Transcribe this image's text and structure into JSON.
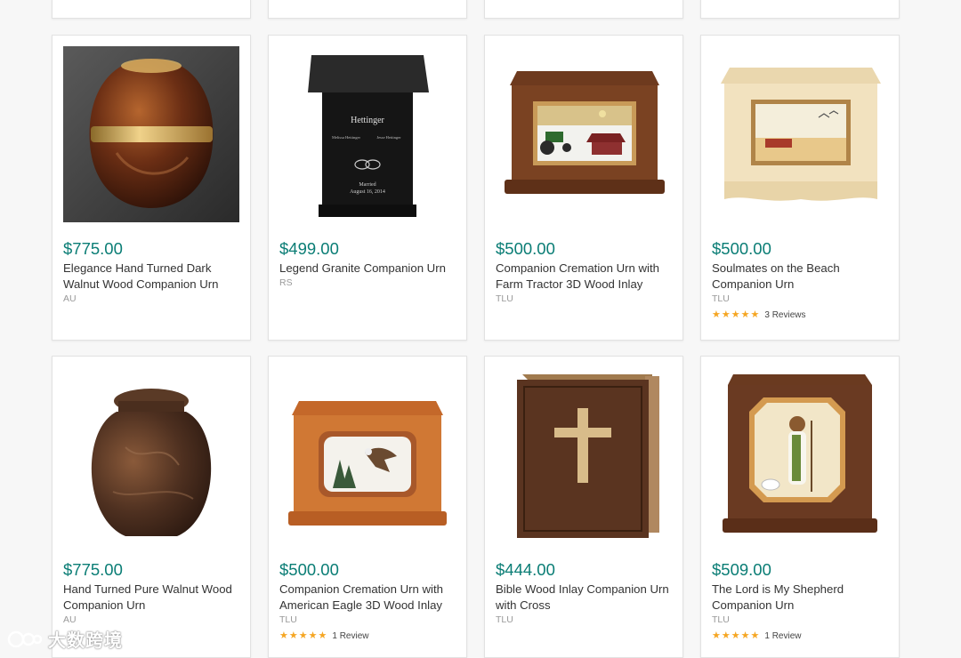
{
  "watermark": {
    "text": "大数跨境"
  },
  "products": [
    {
      "price": "$775.00",
      "title": "Elegance Hand Turned Dark Walnut Wood Companion Urn",
      "vendor": "AU",
      "image": "walnut-urn-with-brass-band"
    },
    {
      "price": "$499.00",
      "title": "Legend Granite Companion Urn",
      "vendor": "RS",
      "image": "black-granite-urn",
      "engraving": {
        "name": "Hettinger",
        "left_name": "Melissa Hettinger",
        "right_name": "Jesse Hettinger",
        "status": "Married",
        "date": "August 16, 2014"
      }
    },
    {
      "price": "$500.00",
      "title": "Companion Cremation Urn with Farm Tractor 3D Wood Inlay",
      "vendor": "TLU",
      "image": "walnut-box-tractor-inlay"
    },
    {
      "price": "$500.00",
      "title": "Soulmates on the Beach Companion Urn",
      "vendor": "TLU",
      "image": "maple-box-beach-inlay",
      "rating": 5,
      "reviews": "3 Reviews"
    },
    {
      "price": "$775.00",
      "title": "Hand Turned Pure Walnut Wood Companion Urn",
      "vendor": "AU",
      "image": "turned-walnut-vase-urn"
    },
    {
      "price": "$500.00",
      "title": "Companion Cremation Urn with American Eagle 3D Wood Inlay",
      "vendor": "TLU",
      "image": "cherry-box-eagle-inlay",
      "rating": 5,
      "reviews": "1 Review"
    },
    {
      "price": "$444.00",
      "title": "Bible Wood Inlay Companion Urn with Cross",
      "vendor": "TLU",
      "image": "walnut-bible-cross-urn"
    },
    {
      "price": "$509.00",
      "title": "The Lord is My Shepherd Companion Urn",
      "vendor": "TLU",
      "image": "walnut-box-shepherd-inlay",
      "rating": 5,
      "reviews": "1 Review"
    }
  ]
}
